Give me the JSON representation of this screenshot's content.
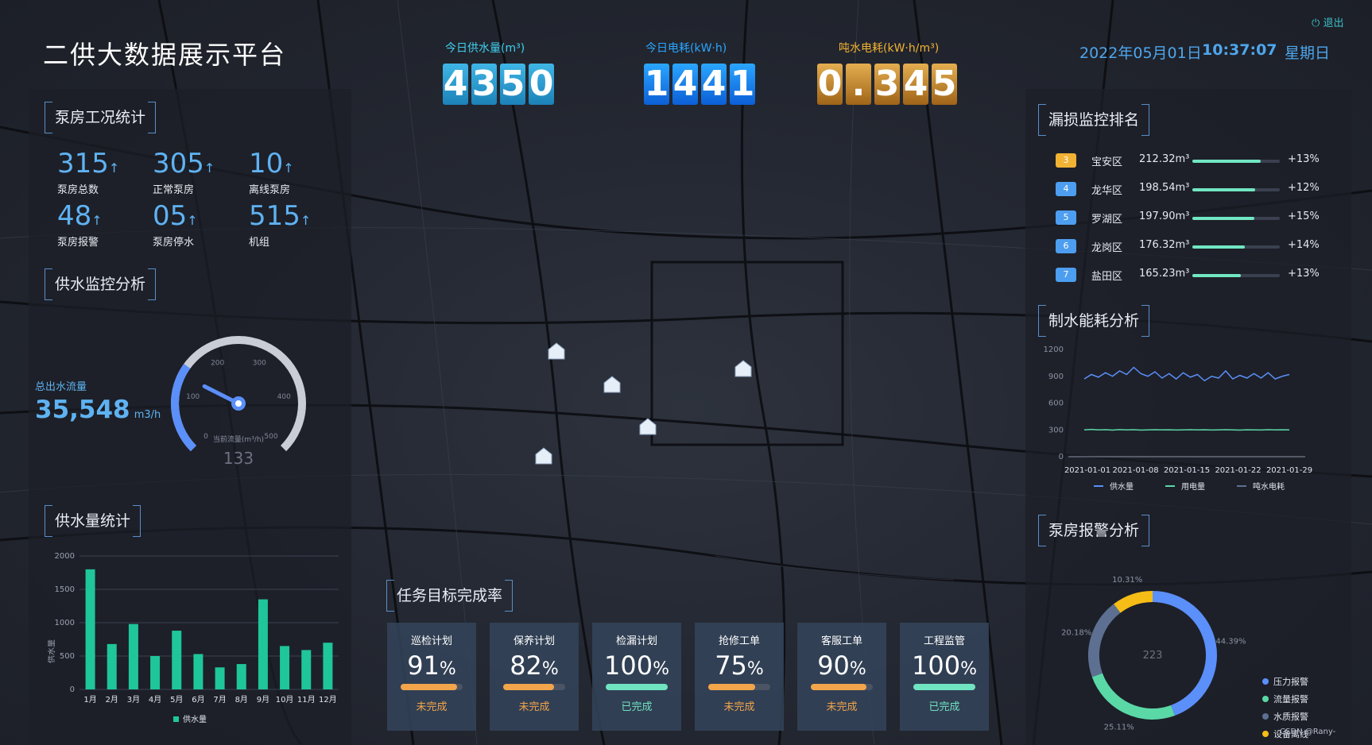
{
  "header": {
    "title": "二供大数据展示平台",
    "kpis": [
      {
        "label": "今日供水量(m³)",
        "digits": [
          "4",
          "3",
          "5",
          "0"
        ],
        "color": "#3fd0f0"
      },
      {
        "label": "今日电耗(kW·h)",
        "digits": [
          "1",
          "4",
          "4",
          "1"
        ],
        "color": "#2aa6ff"
      },
      {
        "label": "吨水电耗(kW·h/m³)",
        "digits": [
          "0",
          ".",
          "3",
          "4",
          "5"
        ],
        "color": "#f2b233"
      }
    ],
    "date": "2022年05月01日",
    "time": "10:37:07",
    "weekday": "星期日",
    "logout": "退出"
  },
  "pump_stats": {
    "title": "泵房工况统计",
    "items": [
      {
        "value": "315",
        "label": "泵房总数"
      },
      {
        "value": "305",
        "label": "正常泵房"
      },
      {
        "value": "10",
        "label": "离线泵房"
      },
      {
        "value": "48",
        "label": "泵房报警"
      },
      {
        "value": "05",
        "label": "泵房停水"
      },
      {
        "value": "515",
        "label": "机组"
      }
    ],
    "arrow": "↑"
  },
  "supply_monitor": {
    "title": "供水监控分析",
    "flow_label": "总出水流量",
    "flow_value": "35,548",
    "flow_unit": "m3/h",
    "gauge": {
      "ticks": [
        "0",
        "100",
        "200",
        "300",
        "400",
        "500"
      ],
      "label": "当前流量(m³/h)",
      "value": "133",
      "value_num": 133,
      "max": 500
    }
  },
  "supply_volume": {
    "title": "供水量统计",
    "legend": "供水量",
    "ylabel": "供水量",
    "chart_data": {
      "type": "bar",
      "categories": [
        "1月",
        "2月",
        "3月",
        "4月",
        "5月",
        "6月",
        "7月",
        "8月",
        "9月",
        "10月",
        "11月",
        "12月"
      ],
      "series": [
        {
          "name": "供水量",
          "values": [
            1800,
            680,
            980,
            500,
            880,
            530,
            330,
            380,
            1350,
            650,
            590,
            700
          ]
        }
      ],
      "yticks": [
        "0",
        "500",
        "1000",
        "1500",
        "2000"
      ],
      "ylim": [
        0,
        2000
      ],
      "color": "#1fc69a"
    }
  },
  "tasks": {
    "title": "任务目标完成率",
    "cards": [
      {
        "name": "巡检计划",
        "value": "91",
        "pct": 91,
        "status": "未完成",
        "status_color": "#f2a54a",
        "bar_color": "#f2a54a"
      },
      {
        "name": "保养计划",
        "value": "82",
        "pct": 82,
        "status": "未完成",
        "status_color": "#f2a54a",
        "bar_color": "#f2a54a"
      },
      {
        "name": "检漏计划",
        "value": "100",
        "pct": 100,
        "status": "已完成",
        "status_color": "#70e3c0",
        "bar_color": "#70e3c0"
      },
      {
        "name": "抢修工单",
        "value": "75",
        "pct": 75,
        "status": "未完成",
        "status_color": "#f2a54a",
        "bar_color": "#f2a54a"
      },
      {
        "name": "客服工单",
        "value": "90",
        "pct": 90,
        "status": "未完成",
        "status_color": "#f2a54a",
        "bar_color": "#f2a54a"
      },
      {
        "name": "工程监管",
        "value": "100",
        "pct": 100,
        "status": "已完成",
        "status_color": "#70e3c0",
        "bar_color": "#70e3c0"
      }
    ],
    "unit": "%"
  },
  "leak_rank": {
    "title": "漏损监控排名",
    "rows": [
      {
        "rank": "3",
        "district": "宝安区",
        "amount": "212.32m³",
        "change": "+13%",
        "pct": 0.78,
        "badge_color": "#f2b233"
      },
      {
        "rank": "4",
        "district": "龙华区",
        "amount": "198.54m³",
        "change": "+12%",
        "pct": 0.72,
        "badge_color": "#4d9ef0"
      },
      {
        "rank": "5",
        "district": "罗湖区",
        "amount": "197.90m³",
        "change": "+15%",
        "pct": 0.71,
        "badge_color": "#4d9ef0"
      },
      {
        "rank": "6",
        "district": "龙岗区",
        "amount": "176.32m³",
        "change": "+14%",
        "pct": 0.6,
        "badge_color": "#4d9ef0"
      },
      {
        "rank": "7",
        "district": "盐田区",
        "amount": "165.23m³",
        "change": "+13%",
        "pct": 0.55,
        "badge_color": "#4d9ef0"
      }
    ]
  },
  "energy": {
    "title": "制水能耗分析",
    "chart_data": {
      "type": "line",
      "x": [
        "2021-01-01",
        "2021-01-08",
        "2021-01-15",
        "2021-01-22",
        "2021-01-29"
      ],
      "yticks": [
        "0",
        "300",
        "600",
        "900",
        "1200"
      ],
      "ylim": [
        0,
        1200
      ],
      "series": [
        {
          "name": "供水量",
          "color": "#5b8ff9",
          "values": [
            870,
            920,
            890,
            940,
            900,
            960,
            920,
            1000,
            930,
            900,
            950,
            880,
            930,
            870,
            940,
            890,
            920,
            850,
            900,
            880,
            960,
            870,
            910,
            880,
            930,
            880,
            940,
            870,
            900,
            920
          ]
        },
        {
          "name": "用电量",
          "color": "#5ad8a6",
          "values": [
            300,
            305,
            300,
            302,
            298,
            303,
            300,
            302,
            298,
            300,
            302,
            300,
            301,
            299,
            300,
            302,
            300,
            301,
            299,
            300,
            302,
            300,
            298,
            301,
            300,
            299,
            302,
            300,
            301,
            300
          ]
        },
        {
          "name": "吨水电耗",
          "color": "#5d7092",
          "values": [
            0,
            0,
            0,
            0,
            0,
            0,
            0,
            0,
            0,
            0,
            0,
            0,
            0,
            0,
            0,
            0,
            0,
            0,
            0,
            0,
            0,
            0,
            0,
            0,
            0,
            0,
            0,
            0,
            0,
            0
          ]
        }
      ]
    }
  },
  "alarm": {
    "title": "泵房报警分析",
    "center_value": "223",
    "chart_data": {
      "type": "pie",
      "categories": [
        "压力报警",
        "流量报警",
        "水质报警",
        "设备离线"
      ],
      "values": [
        44.39,
        25.11,
        20.18,
        10.31
      ],
      "labels": [
        "44.39%",
        "25.11%",
        "20.18%",
        "10.31%"
      ],
      "colors": [
        "#5b8ff9",
        "#5ad8a6",
        "#5d7092",
        "#f6bd16"
      ]
    },
    "watermark": "CSDN @Rany-"
  }
}
